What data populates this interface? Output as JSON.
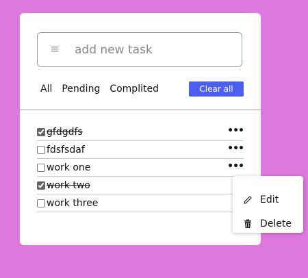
{
  "input": {
    "placeholder": "add new task",
    "icon": "list-icon"
  },
  "filters": [
    "All",
    "Pending",
    "Complited"
  ],
  "clear_label": "Clear all",
  "accent_color": "#4d5ff0",
  "background_color": "#dd78dd",
  "tasks": [
    {
      "label": "gfdgdfs",
      "completed": true
    },
    {
      "label": "fdsfsdaf",
      "completed": false
    },
    {
      "label": "work one",
      "completed": false
    },
    {
      "label": "work two",
      "completed": true
    },
    {
      "label": "work three",
      "completed": false
    }
  ],
  "menu": {
    "edit_label": "Edit",
    "delete_label": "Delete",
    "edit_icon": "pencil-icon",
    "delete_icon": "trash-icon"
  }
}
